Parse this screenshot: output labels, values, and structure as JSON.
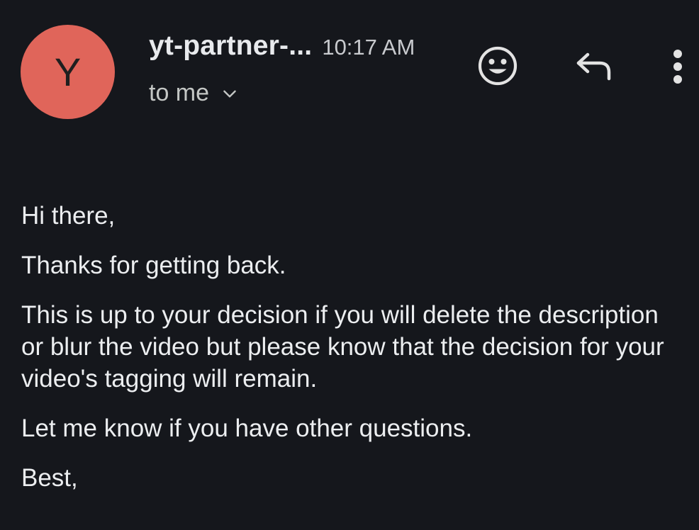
{
  "header": {
    "avatar_letter": "Y",
    "avatar_color": "#e0655a",
    "sender": "yt-partner-...",
    "time": "10:17 AM",
    "recipient_label": "to me"
  },
  "actions": {
    "emoji_icon": "smiley-face-icon",
    "reply_icon": "reply-arrow-icon",
    "more_icon": "vertical-dots-icon"
  },
  "body": {
    "paragraphs": [
      "Hi there,",
      "Thanks for getting back.",
      "This is up to your decision if you will delete the description or blur the video but please know that the decision for your video's tagging will remain.",
      "Let me know if you have other questions.",
      "Best,"
    ]
  },
  "colors": {
    "background": "#15171c",
    "text": "#e8eaed"
  }
}
